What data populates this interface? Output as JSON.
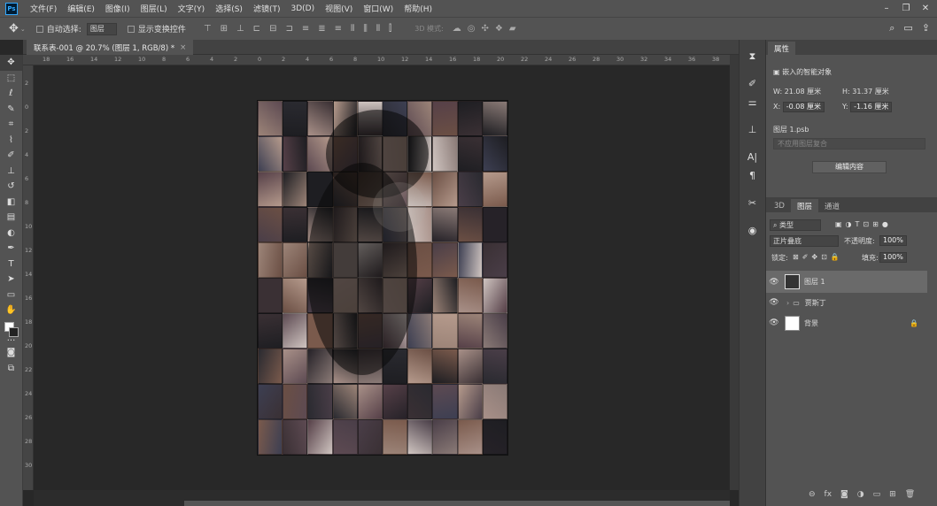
{
  "app": {
    "logo": "Ps"
  },
  "menu": [
    "文件(F)",
    "编辑(E)",
    "图像(I)",
    "图层(L)",
    "文字(Y)",
    "选择(S)",
    "滤镜(T)",
    "3D(D)",
    "视图(V)",
    "窗口(W)",
    "帮助(H)"
  ],
  "options": {
    "auto_select_label": "自动选择:",
    "auto_select_value": "图层",
    "show_transform_label": "显示变换控件",
    "mode_3d_label": "3D 模式:"
  },
  "document": {
    "tab_title": "联系表-001 @ 20.7% (图层 1, RGB/8) *",
    "close": "×"
  },
  "rulers": {
    "horizontal": [
      "18",
      "16",
      "14",
      "12",
      "10",
      "8",
      "6",
      "4",
      "2",
      "0",
      "2",
      "4",
      "6",
      "8",
      "10",
      "12",
      "14",
      "16",
      "18",
      "20",
      "22",
      "24",
      "26",
      "28",
      "30",
      "32",
      "34",
      "36",
      "38"
    ],
    "vertical": [
      "2",
      "0",
      "2",
      "4",
      "6",
      "8",
      "10",
      "12",
      "14",
      "16",
      "18",
      "20",
      "22",
      "24",
      "26",
      "28",
      "30"
    ]
  },
  "properties": {
    "tab": "属性",
    "type_label": "嵌入的智能对象",
    "w_label": "W:",
    "w_value": "21.08 厘米",
    "h_label": "H:",
    "h_value": "31.37 厘米",
    "x_label": "X:",
    "x_value": "-0.08 厘米",
    "y_label": "Y:",
    "y_value": "-1.16 厘米",
    "file_name": "图层 1.psb",
    "comp_placeholder": "不应用图层复合",
    "edit_button": "编辑内容"
  },
  "layers_panel": {
    "tabs": [
      "3D",
      "图层",
      "通道"
    ],
    "filter_label": "类型",
    "blend_mode": "正片叠底",
    "opacity_label": "不透明度:",
    "opacity_value": "100%",
    "lock_label": "锁定:",
    "fill_label": "填充:",
    "fill_value": "100%",
    "layers": [
      {
        "name": "图层 1",
        "selected": true
      },
      {
        "name": "贾斯丁",
        "group": true
      },
      {
        "name": "背景",
        "locked": true
      }
    ]
  },
  "colors": {
    "accent": "#31a8ff",
    "panel": "#535353",
    "workspace": "#282828"
  }
}
